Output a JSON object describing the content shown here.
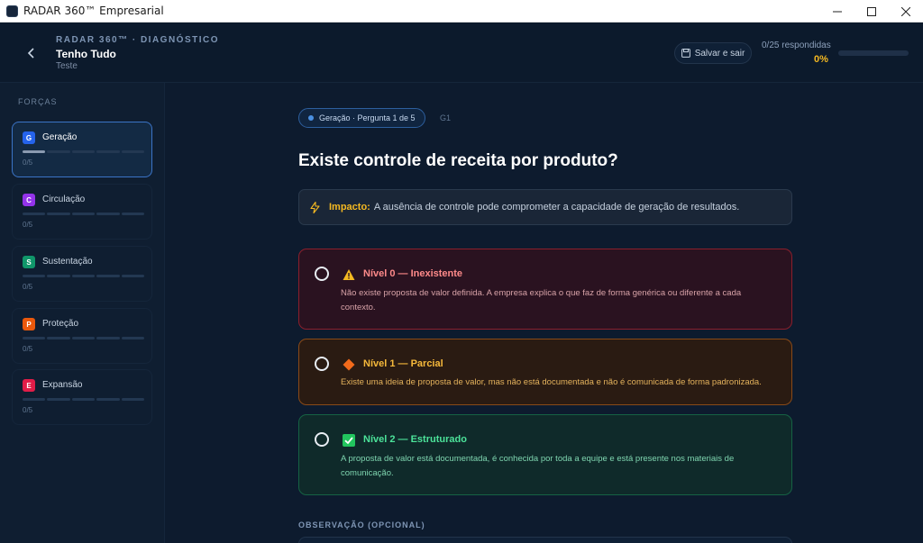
{
  "window": {
    "title": "RADAR 360™ Empresarial"
  },
  "header": {
    "brand": "RADAR 360™ · DIAGNÓSTICO",
    "company": "Tenho Tudo",
    "subtitle": "Teste",
    "save_label": "Salvar e sair",
    "answered": "0/25 respondidas",
    "percent": "0%",
    "progress_fraction": 0.0,
    "accent": "#f5b921"
  },
  "sidebar": {
    "title": "FORÇAS",
    "items": [
      {
        "letter": "G",
        "label": "Geração",
        "count": "0/5",
        "color": "#2563eb",
        "active": true
      },
      {
        "letter": "C",
        "label": "Circulação",
        "count": "0/5",
        "color": "#9333ea",
        "active": false
      },
      {
        "letter": "S",
        "label": "Sustentação",
        "count": "0/5",
        "color": "#10966a",
        "active": false
      },
      {
        "letter": "P",
        "label": "Proteção",
        "count": "0/5",
        "color": "#ea580c",
        "active": false
      },
      {
        "letter": "E",
        "label": "Expansão",
        "count": "0/5",
        "color": "#e11d48",
        "active": false
      }
    ]
  },
  "main": {
    "badge": "Geração · Pergunta 1 de 5",
    "question_id": "G1",
    "question": "Existe controle de receita por produto?",
    "impact_label": "Impacto:",
    "impact_text": "A ausência de controle pode comprometer a capacidade de geração de resultados.",
    "options": [
      {
        "title": "Nível 0 — Inexistente",
        "description": "Não existe proposta de valor definida. A empresa explica o que faz de forma genérica ou diferente a cada contexto.",
        "icon": "warning-icon"
      },
      {
        "title": "Nível 1 — Parcial",
        "description": "Existe uma ideia de proposta de valor, mas não está documentada e não é comunicada de forma padronizada.",
        "icon": "diamond-icon"
      },
      {
        "title": "Nível 2 — Estruturado",
        "description": "A proposta de valor está documentada, é conhecida por toda a equipe e está presente nos materiais de comunicação.",
        "icon": "check-box-icon"
      }
    ],
    "observation_label": "OBSERVAÇÃO (OPCIONAL)"
  }
}
